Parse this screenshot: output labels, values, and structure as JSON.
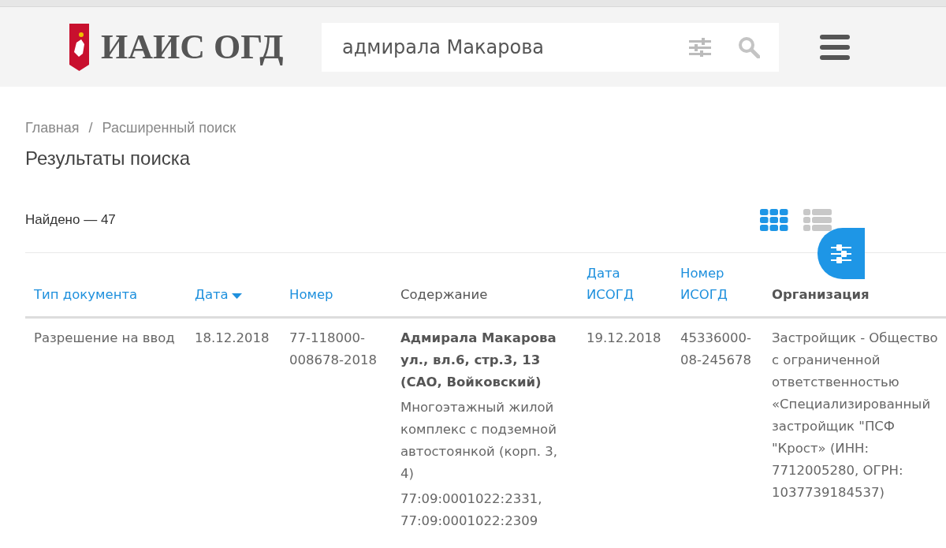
{
  "header": {
    "title": "ИАИС ОГД",
    "search": {
      "value": "адмирала Макарова"
    }
  },
  "breadcrumbs": {
    "items": [
      "Главная",
      "Расширенный поиск"
    ],
    "separator": "/"
  },
  "page_title": "Результаты поиска",
  "found": "Найдено — 47",
  "view_toggles": [
    {
      "kind": "grid",
      "selected": true
    },
    {
      "kind": "list",
      "selected": false
    }
  ],
  "table": {
    "columns": [
      {
        "label": "Тип документа",
        "kind": "link",
        "sorted": false
      },
      {
        "label": "Дата",
        "kind": "link",
        "sorted": true
      },
      {
        "label": "Номер",
        "kind": "link",
        "sorted": false
      },
      {
        "label": "Содержание",
        "kind": "text",
        "sorted": false
      },
      {
        "label": "Дата ИСОГД",
        "kind": "link",
        "sorted": false
      },
      {
        "label": "Номер ИСОГД",
        "kind": "link",
        "sorted": false
      },
      {
        "label": "Организация",
        "kind": "strong",
        "sorted": false
      }
    ],
    "rows": [
      {
        "type": "Разрешение на ввод",
        "date": "18.12.2018",
        "number": "77-118000-008678-2018",
        "content": {
          "address": "Адмирала Макарова ул., вл.6, стр.3, 13 (САО, Войковский)",
          "description": "Многоэтажный жилой комплекс с подземной автостоянкой (корп. 3, 4)",
          "cadastral": "77:09:0001022:2331, 77:09:0001022:2309"
        },
        "isogd_date": "19.12.2018",
        "isogd_number": "45336000-08-245678",
        "organization": "Застройщик - Общество с ограниченной ответственностью «Специализированный застройщик \"ПСФ \"Крост» (ИНН: 7712005280, ОГРН: 1037739184537)"
      }
    ]
  }
}
